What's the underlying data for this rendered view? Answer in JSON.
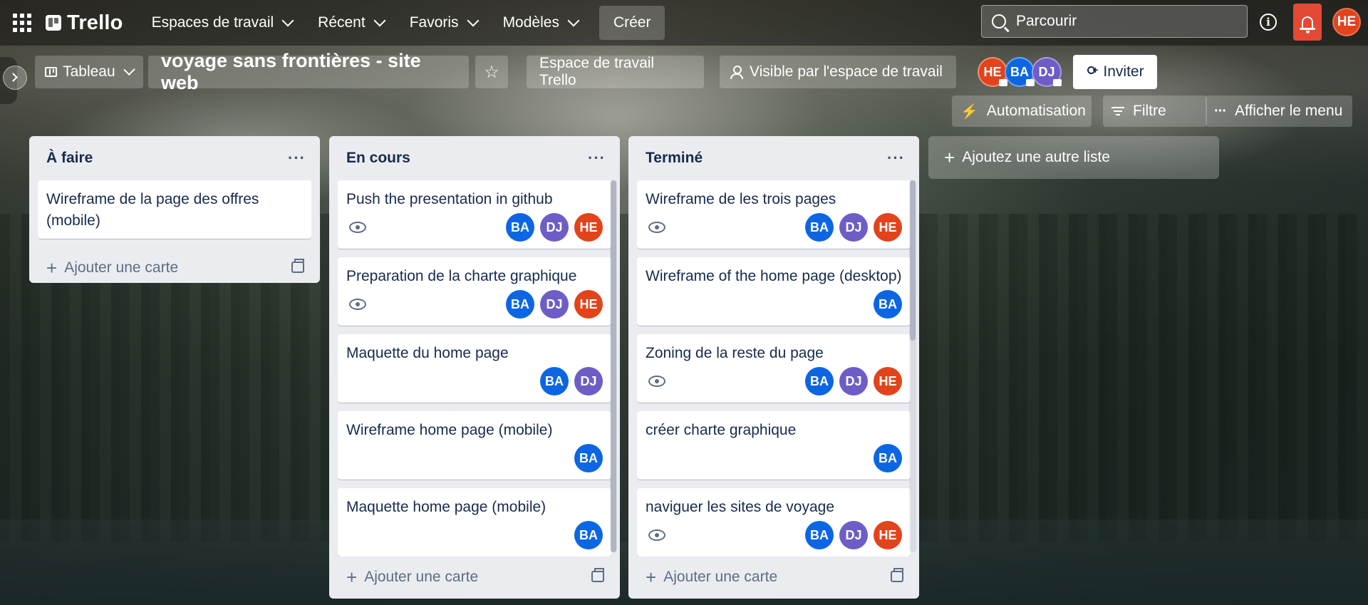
{
  "colors": {
    "ba": "#0c66e4",
    "dj": "#6e5dc6",
    "he": "#e2431b",
    "accent": "#e34935"
  },
  "topbar": {
    "apps_icon": "apps-grid-icon",
    "logo": "Trello",
    "nav": [
      "Espaces de travail",
      "Récent",
      "Favoris",
      "Modèles"
    ],
    "create": "Créer",
    "search_placeholder": "Parcourir",
    "info_icon": "info-icon",
    "notification_icon": "bell-icon",
    "user_initials": "HE"
  },
  "board": {
    "view": "Tableau",
    "title": "voyage sans frontières - site web",
    "star_icon": "star-icon",
    "workspace": "Espace de travail Trello",
    "visibility": "Visible par l'espace de travail",
    "members": [
      "HE",
      "BA",
      "DJ"
    ],
    "invite": "Inviter",
    "automation": "Automatisation",
    "filter": "Filtre",
    "menu": "Afficher le menu",
    "add_list": "Ajoutez une autre liste"
  },
  "lists": [
    {
      "title": "À faire",
      "add_card": "Ajouter une carte",
      "cards": [
        {
          "title": "Wireframe de la page des offres (mobile)",
          "watch": false,
          "members": []
        }
      ]
    },
    {
      "title": "En cours",
      "add_card": "Ajouter une carte",
      "cards": [
        {
          "title": "Push the presentation in github",
          "watch": true,
          "members": [
            "BA",
            "DJ",
            "HE"
          ]
        },
        {
          "title": "Preparation de la charte graphique",
          "watch": true,
          "members": [
            "BA",
            "DJ",
            "HE"
          ]
        },
        {
          "title": "Maquette du home page",
          "watch": false,
          "members": [
            "BA",
            "DJ"
          ]
        },
        {
          "title": "Wireframe home page (mobile)",
          "watch": false,
          "members": [
            "BA"
          ]
        },
        {
          "title": "Maquette home page (mobile)",
          "watch": false,
          "members": [
            "BA"
          ]
        }
      ]
    },
    {
      "title": "Terminé",
      "add_card": "Ajouter une carte",
      "cards": [
        {
          "title": "Wireframe de les trois pages",
          "watch": true,
          "members": [
            "BA",
            "DJ",
            "HE"
          ]
        },
        {
          "title": "Wireframe of the home page (desktop)",
          "watch": false,
          "members": [
            "BA"
          ]
        },
        {
          "title": "Zoning de la reste du page",
          "watch": true,
          "members": [
            "BA",
            "DJ",
            "HE"
          ]
        },
        {
          "title": "créer charte graphique",
          "watch": false,
          "members": [
            "BA"
          ]
        },
        {
          "title": "naviguer les sites de voyage",
          "watch": true,
          "members": [
            "BA",
            "DJ",
            "HE"
          ]
        }
      ]
    }
  ]
}
